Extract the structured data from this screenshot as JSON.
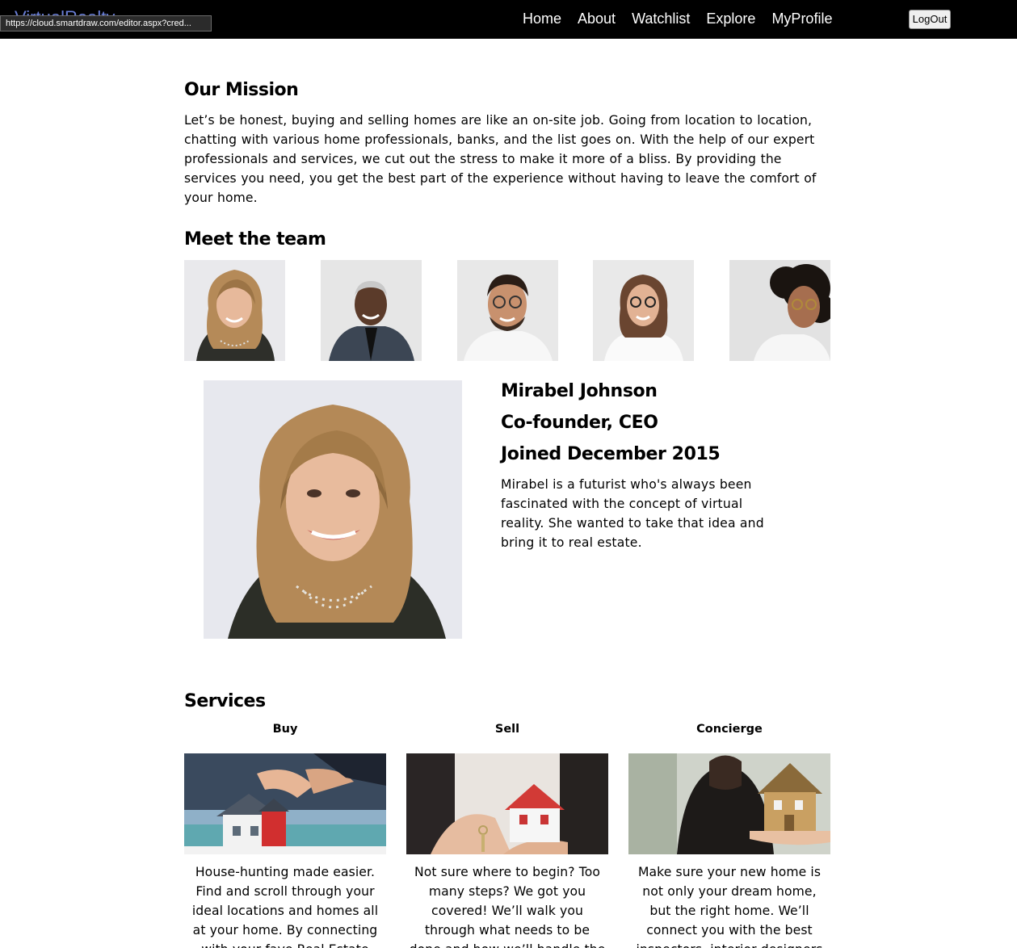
{
  "nav": {
    "brand": "VirtualRealty",
    "url_tooltip": "https://cloud.smartdraw.com/editor.aspx?cred...",
    "links": [
      "Home",
      "About",
      "Watchlist",
      "Explore",
      "MyProfile"
    ],
    "logout": "LogOut"
  },
  "mission": {
    "title": "Our Mission",
    "text": "Let’s be honest, buying and selling homes are like an on-site job. Going from location to location, chatting with various home professionals, banks, and the list goes on. With the help of our expert professionals and services, we cut out the stress to make it more of a bliss. By providing the services you need, you get the best part of the experience without having to leave the comfort of your home."
  },
  "team": {
    "title": "Meet the team",
    "selected": {
      "name": "Mirabel Johnson",
      "role": "Co-founder, CEO",
      "joined": "Joined December 2015",
      "bio": "Mirabel is a futurist who's always been fascinated with the concept of virtual reality. She wanted to take that idea and bring it to real estate."
    }
  },
  "services": {
    "title": "Services",
    "items": [
      {
        "label": "Buy",
        "desc": "House-hunting made easier. Find and scroll through your ideal locations and homes all at your home. By connecting with your fave Real Estate agent"
      },
      {
        "label": "Sell",
        "desc": "Not sure where to begin? Too many steps? We got you covered! We’ll walk you through what needs to be done and how we’ll handle the rest"
      },
      {
        "label": "Concierge",
        "desc": "Make sure your new home is not only your dream home, but the right home. We’ll connect you with the best inspectors, interior designers and others"
      }
    ]
  }
}
